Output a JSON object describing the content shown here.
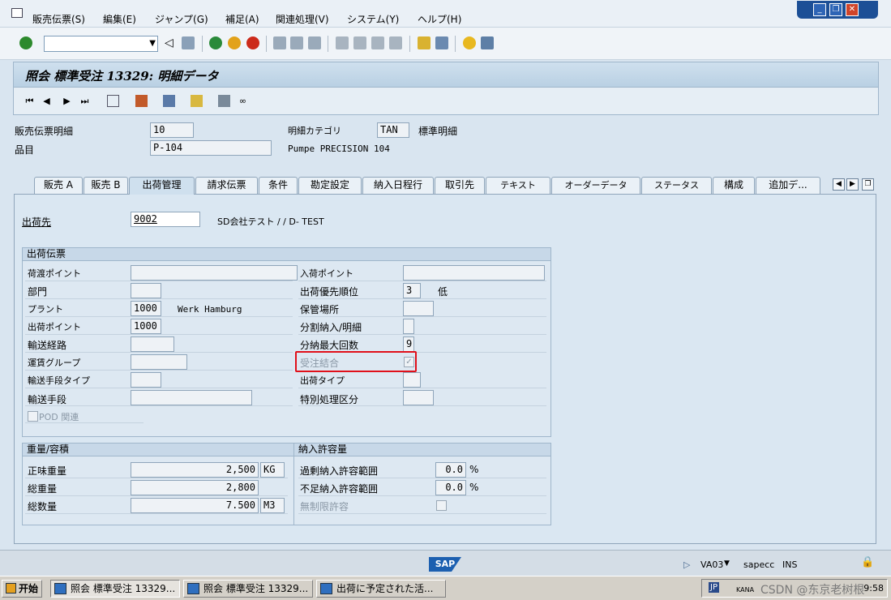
{
  "menu": {
    "items": [
      "販売伝票(S)",
      "編集(E)",
      "ジャンプ(G)",
      "補足(A)",
      "関連処理(V)",
      "システム(Y)",
      "ヘルプ(H)"
    ]
  },
  "toolbar": {
    "command_field": ""
  },
  "title": "照会 標準受注 13329: 明細データ",
  "header": {
    "item_label": "販売伝票明細",
    "item_value": "10",
    "category_label": "明細カテゴリ",
    "category_value": "TAN",
    "category_text": "標準明細",
    "material_label": "品目",
    "material_value": "P-104",
    "material_text": "Pumpe PRECISION 104"
  },
  "tabs": [
    "販売 A",
    "販売 B",
    "出荷管理",
    "請求伝票",
    "条件",
    "勘定設定",
    "納入日程行",
    "取引先",
    "テキスト",
    "オーダーデータ",
    "ステータス",
    "構成",
    "追加デ..."
  ],
  "active_tab": "出荷管理",
  "ship_to": {
    "label": "出荷先",
    "value": "9002",
    "text": "SD会社テスト / / D- TEST"
  },
  "shipping": {
    "title": "出荷伝票",
    "loading_point_label": "荷渡ポイント",
    "loading_point_value": "",
    "unloading_point_label": "入荷ポイント",
    "unloading_point_value": "",
    "department_label": "部門",
    "department_value": "",
    "delivery_priority_label": "出荷優先順位",
    "delivery_priority_value": "3",
    "delivery_priority_text": "低",
    "plant_label": "プラント",
    "plant_value": "1000",
    "plant_text": "Werk Hamburg",
    "storage_location_label": "保管場所",
    "storage_location_value": "",
    "shipping_point_label": "出荷ポイント",
    "shipping_point_value": "1000",
    "partial_delivery_label": "分割納入/明細",
    "partial_delivery_value": "",
    "route_label": "輸送経路",
    "route_value": "",
    "max_partial_label": "分納最大回数",
    "max_partial_value": "9",
    "freight_group_label": "運賃グループ",
    "freight_group_value": "",
    "order_combination_label": "受注結合",
    "order_combination_checked": true,
    "transport_group_label": "輸送手段タイプ",
    "transport_group_value": "",
    "delivery_type_label": "出荷タイプ",
    "delivery_type_value": "",
    "means_of_transport_label": "輸送手段",
    "means_of_transport_value": "",
    "special_processing_label": "特別処理区分",
    "special_processing_value": "",
    "pod_label": "POD 関連"
  },
  "weight": {
    "title": "重量/容積",
    "net_label": "正味重量",
    "net_value": "2,500",
    "net_unit": "KG",
    "gross_label": "総重量",
    "gross_value": "2,800",
    "volume_label": "総数量",
    "volume_value": "7.500",
    "volume_unit": "M3"
  },
  "tolerance": {
    "title": "納入許容量",
    "over_label": "過剰納入許容範囲",
    "over_value": "0.0",
    "over_unit": "%",
    "under_label": "不足納入許容範囲",
    "under_value": "0.0",
    "under_unit": "%",
    "unlimited_label": "無制限許容"
  },
  "status": {
    "transaction": "VA03",
    "client": "sapecc",
    "mode": "INS",
    "logo": "SAP"
  },
  "taskbar": {
    "start": "开始",
    "tasks": [
      "照会 標準受注 13329...",
      "照会 標準受注 13329...",
      "出荷に予定された活..."
    ],
    "lang": "JP",
    "ime": "KANA",
    "time": "9:58",
    "watermark": "CSDN @东京老树根"
  },
  "colors": {
    "highlight": "#e0101a",
    "sap_blue": "#1c5fb0"
  }
}
